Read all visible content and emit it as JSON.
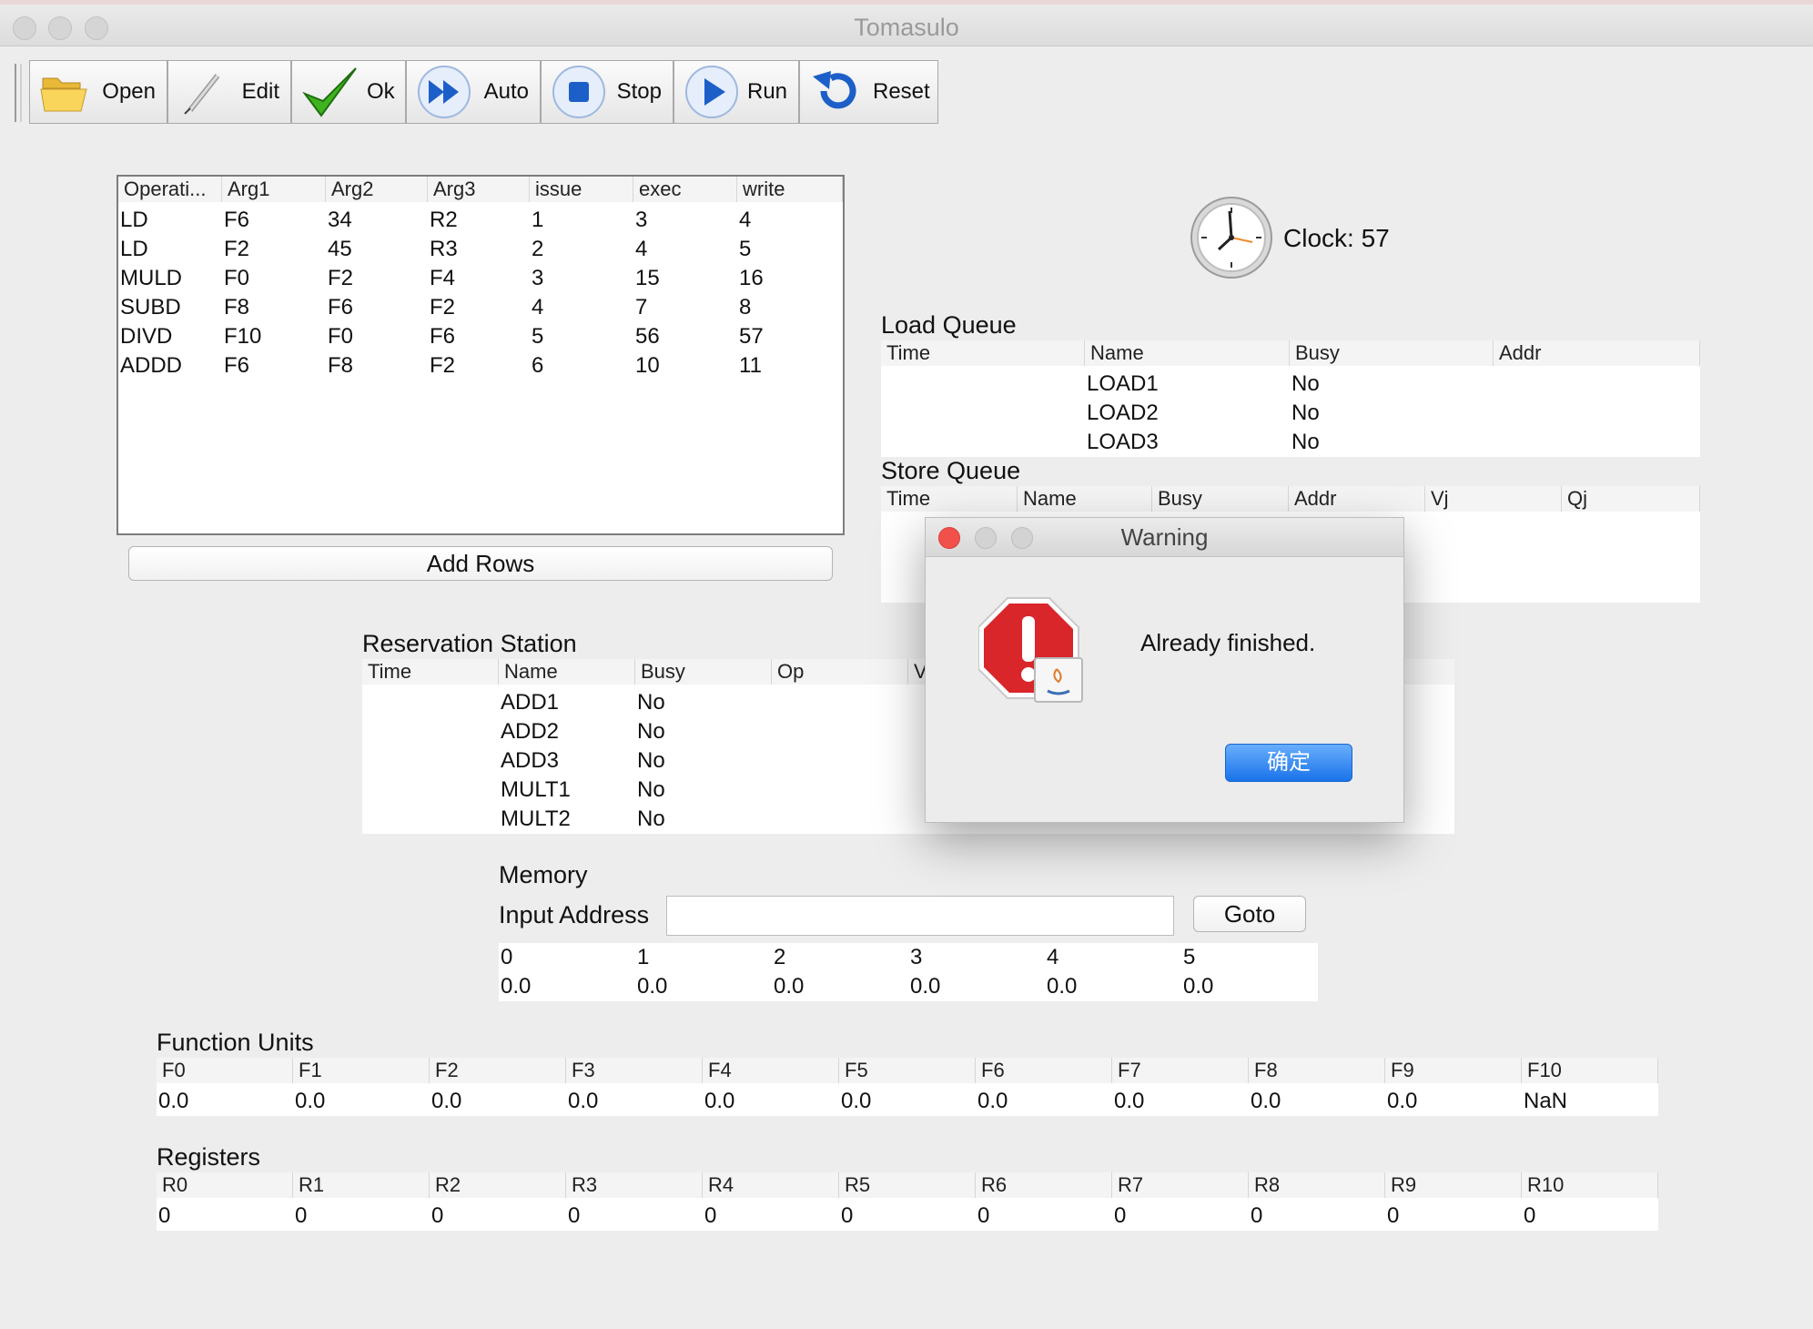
{
  "window": {
    "title": "Tomasulo"
  },
  "toolbar": {
    "buttons": [
      {
        "label": "Open",
        "icon": "folder-icon"
      },
      {
        "label": "Edit",
        "icon": "pencil-icon"
      },
      {
        "label": "Ok",
        "icon": "checkmark-icon"
      },
      {
        "label": "Auto",
        "icon": "fast-forward-icon"
      },
      {
        "label": "Stop",
        "icon": "stop-icon"
      },
      {
        "label": "Run",
        "icon": "play-icon"
      },
      {
        "label": "Reset",
        "icon": "reset-icon"
      }
    ]
  },
  "instructions": {
    "columns": [
      "Operati...",
      "Arg1",
      "Arg2",
      "Arg3",
      "issue",
      "exec",
      "write"
    ],
    "rows": [
      [
        "LD",
        "F6",
        "34",
        "R2",
        "1",
        "3",
        "4"
      ],
      [
        "LD",
        "F2",
        "45",
        "R3",
        "2",
        "4",
        "5"
      ],
      [
        "MULD",
        "F0",
        "F2",
        "F4",
        "3",
        "15",
        "16"
      ],
      [
        "SUBD",
        "F8",
        "F6",
        "F2",
        "4",
        "7",
        "8"
      ],
      [
        "DIVD",
        "F10",
        "F0",
        "F6",
        "5",
        "56",
        "57"
      ],
      [
        "ADDD",
        "F6",
        "F8",
        "F2",
        "6",
        "10",
        "11"
      ]
    ],
    "add_rows_label": "Add Rows"
  },
  "clock": {
    "label": "Clock: 57"
  },
  "load_queue": {
    "title": "Load Queue",
    "columns": [
      "Time",
      "Name",
      "Busy",
      "Addr"
    ],
    "rows": [
      [
        "",
        "LOAD1",
        "No",
        ""
      ],
      [
        "",
        "LOAD2",
        "No",
        ""
      ],
      [
        "",
        "LOAD3",
        "No",
        ""
      ]
    ]
  },
  "store_queue": {
    "title": "Store Queue",
    "columns": [
      "Time",
      "Name",
      "Busy",
      "Addr",
      "Vj",
      "Qj"
    ],
    "rows": []
  },
  "reservation_station": {
    "title": "Reservation Station",
    "columns": [
      "Time",
      "Name",
      "Busy",
      "Op",
      "V"
    ],
    "rows": [
      [
        "",
        "ADD1",
        "No",
        ""
      ],
      [
        "",
        "ADD2",
        "No",
        ""
      ],
      [
        "",
        "ADD3",
        "No",
        ""
      ],
      [
        "",
        "MULT1",
        "No",
        ""
      ],
      [
        "",
        "MULT2",
        "No",
        ""
      ]
    ]
  },
  "memory": {
    "title": "Memory",
    "input_label": "Input Address",
    "input_value": "",
    "goto_label": "Goto",
    "addresses": [
      "0",
      "1",
      "2",
      "3",
      "4",
      "5"
    ],
    "values": [
      "0.0",
      "0.0",
      "0.0",
      "0.0",
      "0.0",
      "0.0"
    ]
  },
  "function_units": {
    "title": "Function Units",
    "names": [
      "F0",
      "F1",
      "F2",
      "F3",
      "F4",
      "F5",
      "F6",
      "F7",
      "F8",
      "F9",
      "F10"
    ],
    "values": [
      "0.0",
      "0.0",
      "0.0",
      "0.0",
      "0.0",
      "0.0",
      "0.0",
      "0.0",
      "0.0",
      "0.0",
      "NaN"
    ]
  },
  "registers": {
    "title": "Registers",
    "names": [
      "R0",
      "R1",
      "R2",
      "R3",
      "R4",
      "R5",
      "R6",
      "R7",
      "R8",
      "R9",
      "R10"
    ],
    "values": [
      "0",
      "0",
      "0",
      "0",
      "0",
      "0",
      "0",
      "0",
      "0",
      "0",
      "0"
    ]
  },
  "dialog": {
    "title": "Warning",
    "message": "Already finished.",
    "ok_label": "确定",
    "icon": "error-icon"
  },
  "colors": {
    "dialog_button": "#1a73ea",
    "error_icon": "#d9262b",
    "close_dot": "#f2504a"
  }
}
